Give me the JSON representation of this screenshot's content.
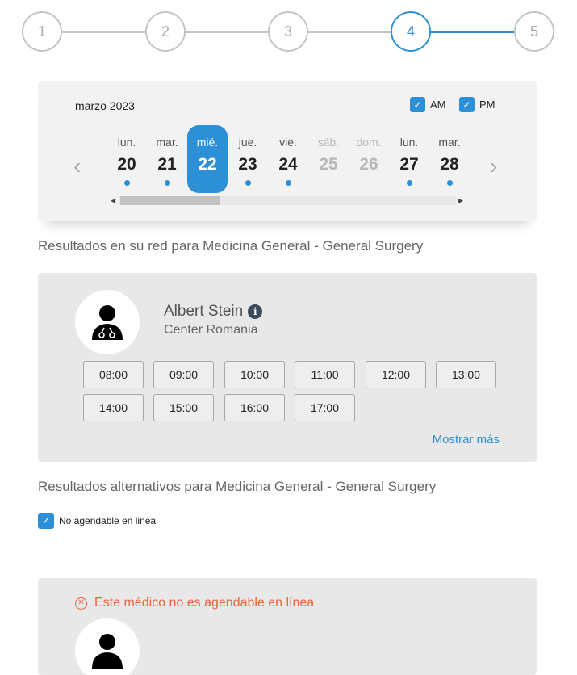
{
  "stepper": {
    "steps": [
      "1",
      "2",
      "3",
      "4",
      "5"
    ],
    "active_step": "4"
  },
  "calendar": {
    "month_label": "marzo 2023",
    "am_label": "AM",
    "pm_label": "PM",
    "am_checked": true,
    "pm_checked": true,
    "days": [
      {
        "name": "lun.",
        "num": "20",
        "available": true,
        "selected": false,
        "disabled": false
      },
      {
        "name": "mar.",
        "num": "21",
        "available": true,
        "selected": false,
        "disabled": false
      },
      {
        "name": "mié.",
        "num": "22",
        "available": false,
        "selected": true,
        "disabled": false
      },
      {
        "name": "jue.",
        "num": "23",
        "available": true,
        "selected": false,
        "disabled": false
      },
      {
        "name": "vie.",
        "num": "24",
        "available": true,
        "selected": false,
        "disabled": false
      },
      {
        "name": "sáb.",
        "num": "25",
        "available": false,
        "selected": false,
        "disabled": true
      },
      {
        "name": "dom.",
        "num": "26",
        "available": false,
        "selected": false,
        "disabled": true
      },
      {
        "name": "lun.",
        "num": "27",
        "available": true,
        "selected": false,
        "disabled": false
      },
      {
        "name": "mar.",
        "num": "28",
        "available": true,
        "selected": false,
        "disabled": false
      }
    ],
    "prev_icon": "chevron-left-icon",
    "next_icon": "chevron-right-icon"
  },
  "results": {
    "network_title": "Resultados en su red  para  Medicina General - General Surgery",
    "alternative_title": "Resultados alternativos  para  Medicina General - General Surgery"
  },
  "doctor": {
    "name": "Albert Stein",
    "center": "Center Romania",
    "slots": [
      "08:00",
      "09:00",
      "10:00",
      "11:00",
      "12:00",
      "13:00",
      "14:00",
      "15:00",
      "16:00",
      "17:00"
    ],
    "show_more": "Mostrar más"
  },
  "filters": {
    "no_online_label": "No agendable en linea",
    "no_online_checked": true
  },
  "alt_doctor": {
    "warning": "Este médico no es agendable en línea"
  },
  "colors": {
    "accent": "#2d8fd5",
    "warning": "#e8643a",
    "card_bg": "#e8e8e8"
  }
}
